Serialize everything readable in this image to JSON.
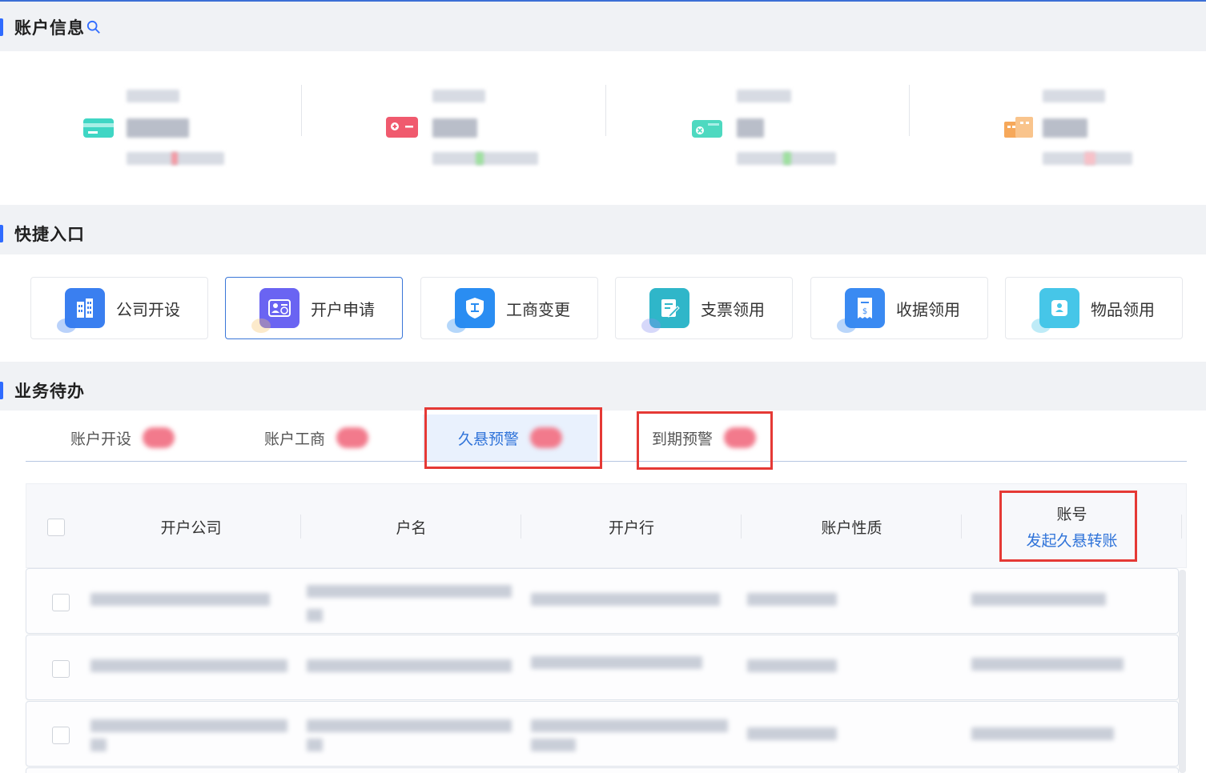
{
  "sections": {
    "account_info": {
      "title": "账户信息"
    },
    "quick_entry": {
      "title": "快捷入口"
    },
    "todo": {
      "title": "业务待办"
    }
  },
  "account_cards": [
    {
      "icon": "bank-card-icon",
      "color": "#3fd6c4"
    },
    {
      "icon": "card-minus-icon",
      "color": "#f05a6e"
    },
    {
      "icon": "card-cancel-icon",
      "color": "#4ed9c0"
    },
    {
      "icon": "building-calendar-icon",
      "color": "#f6a85a"
    }
  ],
  "quick_entries": [
    {
      "label": "公司开设",
      "icon": "building-icon",
      "color": "#3a7ff0"
    },
    {
      "label": "开户申请",
      "icon": "id-card-icon",
      "color": "#6a64f2"
    },
    {
      "label": "工商变更",
      "icon": "shield-icon",
      "color": "#2a8df2"
    },
    {
      "label": "支票领用",
      "icon": "edit-doc-icon",
      "color": "#2fb6c9"
    },
    {
      "label": "收据领用",
      "icon": "receipt-icon",
      "color": "#3a8af2"
    },
    {
      "label": "物品领用",
      "icon": "box-person-icon",
      "color": "#46c6e8"
    }
  ],
  "tabs": [
    {
      "label": "账户开设"
    },
    {
      "label": "账户工商"
    },
    {
      "label": "久悬预警"
    },
    {
      "label": "到期预警"
    }
  ],
  "table": {
    "headers": [
      "开户公司",
      "户名",
      "开户行",
      "账户性质",
      "账号"
    ],
    "action_link": "发起久悬转账"
  }
}
